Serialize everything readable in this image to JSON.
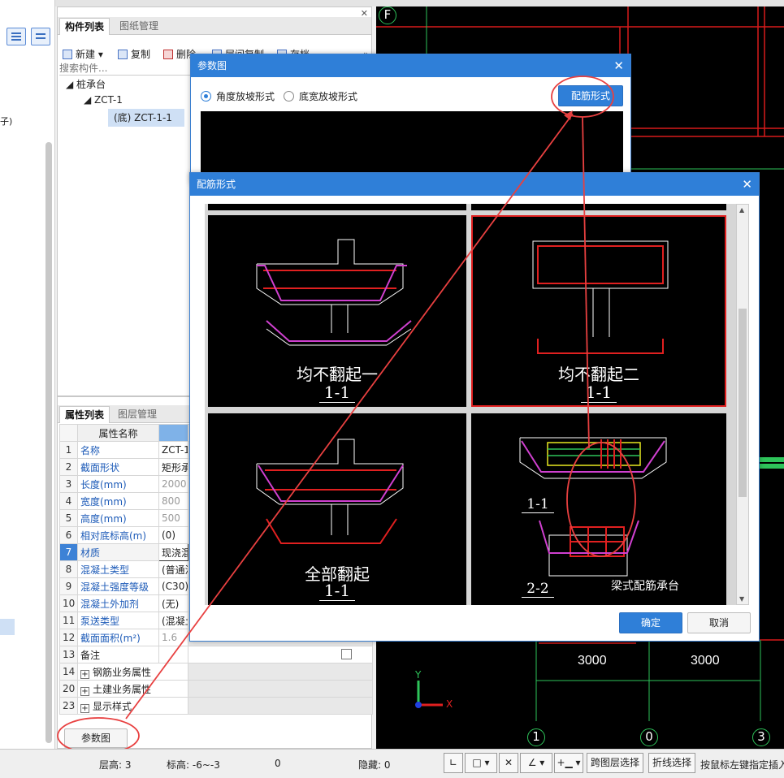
{
  "component_list": {
    "tab_active": "构件列表",
    "tab_other": "图纸管理",
    "toolbar": {
      "new": "新建",
      "copy": "复制",
      "delete": "删除",
      "layer_copy": "层间复制",
      "archive": "存档"
    },
    "search_placeholder": "搜索构件...",
    "tree": {
      "root": "桩承台",
      "child": "ZCT-1",
      "leaf": "(底) ZCT-1-1"
    }
  },
  "left_strip": {
    "partial_text": "子)"
  },
  "property_list": {
    "tab_active": "属性列表",
    "tab_other": "图层管理",
    "header_name": "属性名称",
    "rows": [
      {
        "num": "1",
        "name": "名称",
        "value": "ZCT-1"
      },
      {
        "num": "2",
        "name": "截面形状",
        "value": "矩形承"
      },
      {
        "num": "3",
        "name": "长度(mm)",
        "value": "2000"
      },
      {
        "num": "4",
        "name": "宽度(mm)",
        "value": "800"
      },
      {
        "num": "5",
        "name": "高度(mm)",
        "value": "500"
      },
      {
        "num": "6",
        "name": "相对底标高(m)",
        "value": "(0)"
      },
      {
        "num": "7",
        "name": "材质",
        "value": "现浇混"
      },
      {
        "num": "8",
        "name": "混凝土类型",
        "value": "(普通混"
      },
      {
        "num": "9",
        "name": "混凝土强度等级",
        "value": "(C30)"
      },
      {
        "num": "10",
        "name": "混凝土外加剂",
        "value": "(无)"
      },
      {
        "num": "11",
        "name": "泵送类型",
        "value": "(混凝土"
      },
      {
        "num": "12",
        "name": "截面面积(m²)",
        "value": "1.6"
      },
      {
        "num": "13",
        "name": "备注",
        "value": ""
      },
      {
        "num": "14",
        "name": "钢筋业务属性",
        "value": ""
      },
      {
        "num": "20",
        "name": "土建业务属性",
        "value": ""
      },
      {
        "num": "23",
        "name": "显示样式",
        "value": ""
      }
    ],
    "param_button": "参数图"
  },
  "dialog_param": {
    "title": "参数图",
    "radio_1": "角度放坡形式",
    "radio_2": "底宽放坡形式",
    "rebar_button": "配筋形式"
  },
  "dialog_rebar": {
    "title": "配筋形式",
    "options": [
      {
        "caption": "均不翻起一",
        "section": "1-1"
      },
      {
        "caption": "均不翻起二",
        "section": "1-1"
      },
      {
        "caption": "全部翻起",
        "section": "1-1"
      },
      {
        "caption": "梁式配筋承台",
        "section_top": "1-1",
        "section_bottom": "2-2"
      }
    ],
    "ok": "确定",
    "cancel": "取消"
  },
  "cad": {
    "axis_top": "F",
    "dims": [
      "3000",
      "3000"
    ],
    "axis_bottom": [
      "1",
      "0",
      "3"
    ],
    "x_label": "X",
    "y_label": "Y"
  },
  "status_bar": {
    "floor_height_label": "层高:",
    "floor_height": "3",
    "elevation_label": "标高:",
    "elevation": "-6~-3",
    "zero": "0",
    "hidden_label": "隐藏:",
    "hidden": "0",
    "cross_layer": "跨图层选择",
    "polyline": "折线选择",
    "hint": "按鼠标左键指定插入"
  },
  "colors": {
    "accent": "#2f7fd8",
    "annotation": "#e84040",
    "cad_bg": "#000000",
    "cad_red": "#d81b1b",
    "cad_green": "#2ec45a"
  }
}
